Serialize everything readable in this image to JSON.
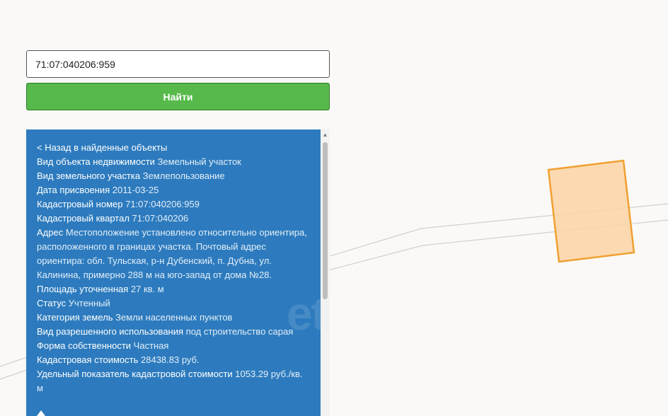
{
  "search": {
    "value": "71:07:040206:959",
    "button_label": "Найти"
  },
  "info": {
    "back_label": "< Назад в найденные объекты",
    "rows": [
      {
        "label": "Вид объекта недвижимости",
        "value": "Земельный участок"
      },
      {
        "label": "Вид земельного участка",
        "value": "Землепользование"
      },
      {
        "label": "Дата присвоения",
        "value": "2011-03-25"
      },
      {
        "label": "Кадастровый номер",
        "value": "71:07:040206:959"
      },
      {
        "label": "Кадастровый квартал",
        "value": "71:07:040206"
      },
      {
        "label": "Адрес",
        "value": "Местоположение установлено относительно ориентира, расположенного в границах участка. Почтовый адрес ориентира: обл. Тульская, р-н Дубенский, п. Дубна, ул. Калинина, примерно 288 м на юго-запад от дома №28."
      },
      {
        "label": "Площадь уточненная",
        "value": "27 кв. м"
      },
      {
        "label": "Статус",
        "value": "Учтенный"
      },
      {
        "label": "Категория земель",
        "value": "Земли населенных пунктов"
      },
      {
        "label": "Вид разрешенного использования",
        "value": "под строительство сарая"
      },
      {
        "label": "Форма собственности",
        "value": "Частная"
      },
      {
        "label": "Кадастровая стоимость",
        "value": "28438.83 руб."
      },
      {
        "label": "Удельный показатель кадастровой стоимости",
        "value": "1053.29 руб./кв. м"
      }
    ]
  },
  "colors": {
    "panel": "#2d7bbe",
    "button": "#56b94a",
    "parcel_fill": "#fcd3a4",
    "parcel_stroke": "#f0a030"
  },
  "icons": {
    "scroll_up": "triangle-up",
    "bottom_arrow": "triangle-up"
  }
}
